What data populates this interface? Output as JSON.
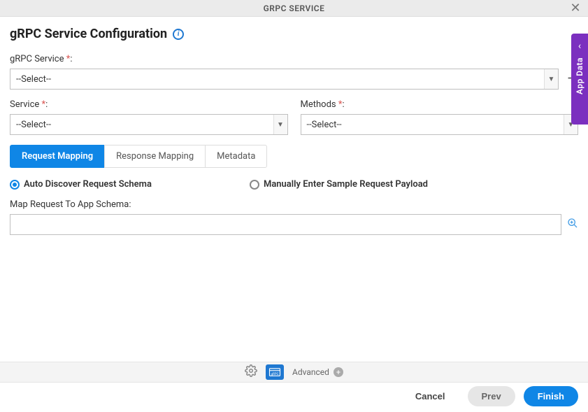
{
  "header": {
    "title": "GRPC SERVICE"
  },
  "page": {
    "title": "gRPC Service Configuration"
  },
  "fields": {
    "grpc_service": {
      "label": "gRPC Service",
      "value": "--Select--"
    },
    "service": {
      "label": "Service",
      "value": "--Select--"
    },
    "methods": {
      "label": "Methods",
      "value": "--Select--"
    },
    "map_request": {
      "label": "Map Request To App Schema:",
      "value": ""
    }
  },
  "tabs": [
    {
      "label": "Request Mapping",
      "active": true
    },
    {
      "label": "Response Mapping",
      "active": false
    },
    {
      "label": "Metadata",
      "active": false
    }
  ],
  "radios": {
    "auto": "Auto Discover Request Schema",
    "manual": "Manually Enter Sample Request Payload"
  },
  "toolbar": {
    "advanced": "Advanced"
  },
  "footer": {
    "cancel": "Cancel",
    "prev": "Prev",
    "finish": "Finish"
  },
  "side_panel": {
    "label": "App Data"
  }
}
